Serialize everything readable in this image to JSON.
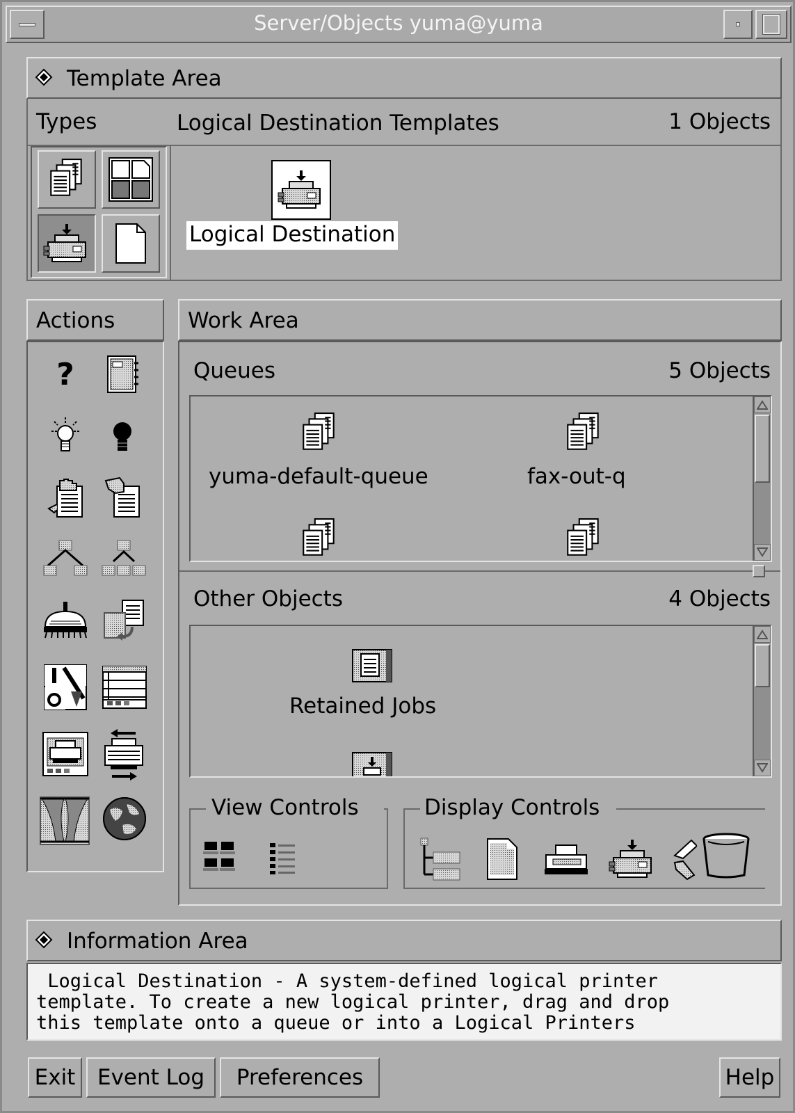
{
  "window": {
    "title": "Server/Objects yuma@yuma",
    "menu_icon": "window-menu-icon",
    "minimize_icon": "minimize-icon",
    "maximize_icon": "maximize-icon"
  },
  "template_area": {
    "title": "Template Area",
    "types_label": "Types",
    "section_title": "Logical Destination Templates",
    "count": "1 Objects",
    "types": [
      "queue-type-icon",
      "layout-type-icon",
      "logical-destination-type-icon",
      "document-type-icon"
    ],
    "items": [
      {
        "label": "Logical Destination",
        "icon": "logical-destination-icon",
        "selected": true
      }
    ]
  },
  "actions": {
    "title": "Actions",
    "icons": [
      "help-icon",
      "notebook-icon",
      "light-on-icon",
      "light-off-icon",
      "hold-job-icon",
      "release-job-icon",
      "show-tree-icon",
      "hide-tree-icon",
      "clean-icon",
      "copy-icon",
      "enable-disable-icon",
      "table-view-icon",
      "printer-panel-icon",
      "transfer-icon",
      "curtain-icon",
      "globe-icon"
    ]
  },
  "work_area": {
    "title": "Work Area",
    "queues": {
      "title": "Queues",
      "count": "5 Objects",
      "items": [
        {
          "label": "yuma-default-queue"
        },
        {
          "label": "fax-out-q"
        },
        {
          "label": ""
        },
        {
          "label": ""
        }
      ]
    },
    "other": {
      "title": "Other Objects",
      "count": "4 Objects",
      "items": [
        {
          "label": "Retained Jobs"
        },
        {
          "label": ""
        }
      ]
    },
    "view_controls": {
      "title": "View Controls",
      "icons": [
        "icon-view-icon",
        "details-view-icon"
      ]
    },
    "display_controls": {
      "title": "Display Controls",
      "icons": [
        "tree-display-icon",
        "document-display-icon",
        "printer-display-icon",
        "logical-destination-display-icon",
        "arrow-display-icon",
        "trash-can-icon"
      ]
    }
  },
  "information_area": {
    "title": "Information Area",
    "text": " Logical Destination - A system-defined logical printer\ntemplate. To create a new logical printer, drag and drop\nthis template onto a queue or into a Logical Printers"
  },
  "buttons": {
    "exit": "Exit",
    "event_log": "Event Log",
    "preferences": "Preferences",
    "help": "Help"
  },
  "colors": {
    "background": "#aeaeae",
    "info_background": "#f2f2f2",
    "selection": "#ffffff"
  }
}
